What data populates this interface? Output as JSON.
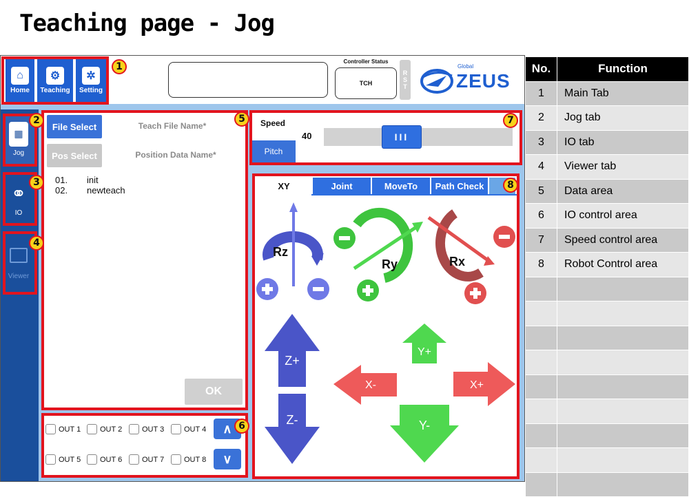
{
  "page_title": "Teaching page - Jog",
  "main_tabs": [
    {
      "label": "Home",
      "icon": "home-icon"
    },
    {
      "label": "Teaching",
      "icon": "robot-arm-icon"
    },
    {
      "label": "Setting",
      "icon": "gear-icon"
    }
  ],
  "controller_status": {
    "label": "Controller Status",
    "value": "TCH"
  },
  "rst_label": "RST",
  "logo": {
    "small": "Global",
    "brand": "ZEUS"
  },
  "side_tabs": [
    {
      "label": "Jog",
      "icon": "remote-control-icon"
    },
    {
      "label": "IO",
      "icon": "usb-icon"
    },
    {
      "label": "Viewer",
      "icon": "monitor-icon"
    }
  ],
  "data_area": {
    "file_select": "File Select",
    "teach_file_name": "Teach File Name*",
    "pos_select": "Pos Select",
    "position_data_name": "Position Data Name*",
    "files": [
      {
        "no": "01.",
        "name": "init"
      },
      {
        "no": "02.",
        "name": "newteach"
      }
    ],
    "ok": "OK"
  },
  "io_area": {
    "outputs": [
      "OUT 1",
      "OUT 2",
      "OUT 3",
      "OUT 4",
      "OUT 5",
      "OUT 6",
      "OUT 7",
      "OUT 8"
    ],
    "up": "∧",
    "down": "∨"
  },
  "speed_area": {
    "label": "Speed",
    "value": "40",
    "pitch": "Pitch",
    "slider_level": 40
  },
  "robot_control": {
    "tabs": [
      "XY",
      "Joint",
      "MoveTo",
      "Path Check"
    ],
    "rotations": [
      "Rz",
      "Ry",
      "Rx"
    ],
    "arrows": [
      "Z+",
      "Z-",
      "Y+",
      "Y-",
      "X-",
      "X+"
    ]
  },
  "callouts": [
    "1",
    "2",
    "3",
    "4",
    "5",
    "6",
    "7",
    "8"
  ],
  "function_table": {
    "header_no": "No.",
    "header_function": "Function",
    "rows": [
      {
        "no": "1",
        "function": "Main Tab"
      },
      {
        "no": "2",
        "function": "Jog tab"
      },
      {
        "no": "3",
        "function": "IO tab"
      },
      {
        "no": "4",
        "function": "Viewer tab"
      },
      {
        "no": "5",
        "function": "Data area"
      },
      {
        "no": "6",
        "function": "IO control area"
      },
      {
        "no": "7",
        "function": "Speed control area"
      },
      {
        "no": "8",
        "function": "Robot Control area"
      }
    ]
  },
  "colors": {
    "accent": "#1f5fd0",
    "callout_border": "#e2141e",
    "callout_fill": "#f7d21a",
    "sidebar": "#1a4f9c"
  }
}
